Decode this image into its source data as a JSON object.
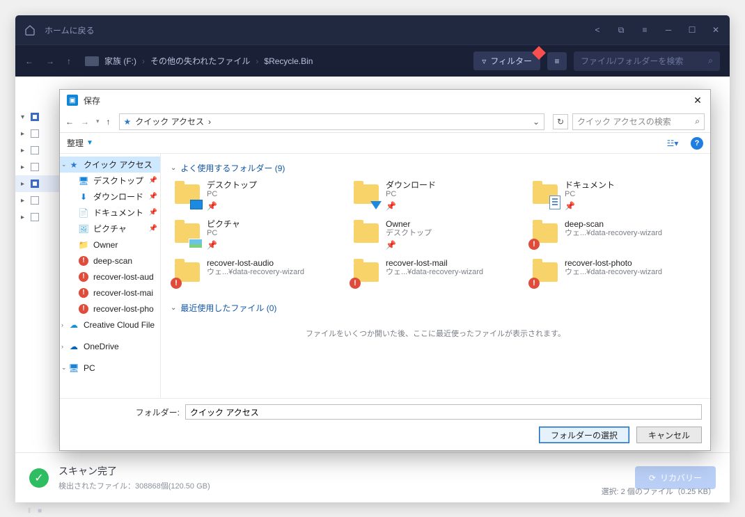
{
  "titlebar": {
    "home_label": "ホームに戻る"
  },
  "toolbar": {
    "breadcrumb": [
      "家族 (F:)",
      "その他の失われたファイル",
      "$Recycle.Bin"
    ],
    "filter_label": "フィルター",
    "search_placeholder": "ファイル/フォルダーを検索"
  },
  "status": {
    "title": "スキャン完了",
    "detail": "検出されたファイル：308868個(120.50 GB)",
    "recover_label": "リカバリー",
    "selection": "選択: 2 個のファイル（0.25 KB）"
  },
  "picker": {
    "title": "保存",
    "address_label": "クイック アクセス",
    "search_placeholder": "クイック アクセスの検索",
    "organize_label": "整理",
    "sidebar": [
      {
        "icon": "star",
        "label": "クイック アクセス",
        "selected": true,
        "exp": "∨"
      },
      {
        "icon": "monitor",
        "label": "デスクトップ",
        "pin": true,
        "indent": true
      },
      {
        "icon": "download",
        "label": "ダウンロード",
        "pin": true,
        "indent": true
      },
      {
        "icon": "doc",
        "label": "ドキュメント",
        "pin": true,
        "indent": true
      },
      {
        "icon": "pic",
        "label": "ピクチャ",
        "pin": true,
        "indent": true
      },
      {
        "icon": "folder",
        "label": "Owner",
        "indent": true
      },
      {
        "icon": "warn",
        "label": "deep-scan",
        "indent": true
      },
      {
        "icon": "warn",
        "label": "recover-lost-audio",
        "indent": true,
        "trunc": "recover-lost-aud"
      },
      {
        "icon": "warn",
        "label": "recover-lost-mail",
        "indent": true,
        "trunc": "recover-lost-mai"
      },
      {
        "icon": "warn",
        "label": "recover-lost-photo",
        "indent": true,
        "trunc": "recover-lost-pho"
      },
      {
        "icon": "cloud",
        "label": "Creative Cloud Files",
        "exp": ">",
        "trunc": "Creative Cloud File"
      },
      {
        "icon": "onedrive",
        "label": "OneDrive",
        "exp": ">"
      },
      {
        "icon": "pc",
        "label": "PC",
        "exp": "∨"
      }
    ],
    "section1": "よく使用するフォルダー (9)",
    "folders": [
      {
        "name": "デスクトップ",
        "sub": "PC",
        "icon": "monitor",
        "pin": true
      },
      {
        "name": "ダウンロード",
        "sub": "PC",
        "icon": "download",
        "pin": true
      },
      {
        "name": "ドキュメント",
        "sub": "PC",
        "icon": "doc",
        "pin": true
      },
      {
        "name": "ピクチャ",
        "sub": "PC",
        "icon": "pic",
        "pin": true
      },
      {
        "name": "Owner",
        "sub": "デスクトップ",
        "icon": "folder",
        "pin": true
      },
      {
        "name": "deep-scan",
        "sub": "ウェ...¥data-recovery-wizard",
        "icon": "warn"
      },
      {
        "name": "recover-lost-audio",
        "sub": "ウェ...¥data-recovery-wizard",
        "icon": "warn"
      },
      {
        "name": "recover-lost-mail",
        "sub": "ウェ...¥data-recovery-wizard",
        "icon": "warn"
      },
      {
        "name": "recover-lost-photo",
        "sub": "ウェ...¥data-recovery-wizard",
        "icon": "warn"
      }
    ],
    "section2": "最近使用したファイル (0)",
    "recent_msg": "ファイルをいくつか開いた後、ここに最近使ったファイルが表示されます。",
    "folder_label": "フォルダー:",
    "folder_value": "クイック アクセス",
    "select_btn": "フォルダーの選択",
    "cancel_btn": "キャンセル"
  }
}
